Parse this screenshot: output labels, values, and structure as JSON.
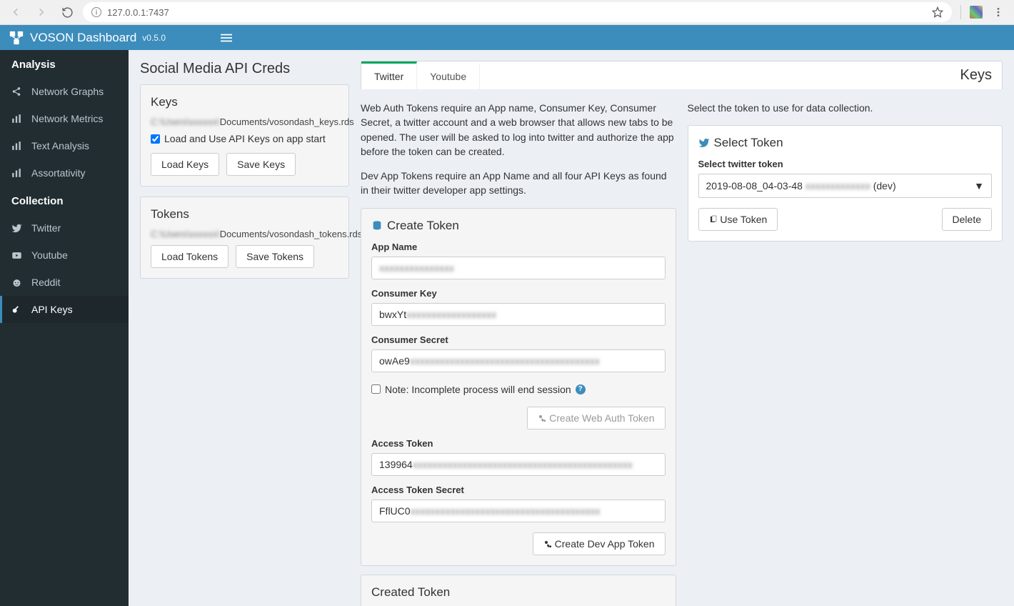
{
  "browser": {
    "url": "127.0.0.1:7437"
  },
  "header": {
    "title": "VOSON Dashboard",
    "version": "v0.5.0"
  },
  "sidebar": {
    "section1": "Analysis",
    "items1": [
      {
        "label": "Network Graphs"
      },
      {
        "label": "Network Metrics"
      },
      {
        "label": "Text Analysis"
      },
      {
        "label": "Assortativity"
      }
    ],
    "section2": "Collection",
    "items2": [
      {
        "label": "Twitter"
      },
      {
        "label": "Youtube"
      },
      {
        "label": "Reddit"
      },
      {
        "label": "API Keys"
      }
    ]
  },
  "creds": {
    "title": "Social Media API Creds",
    "keys_header": "Keys",
    "keys_path_suffix": "Documents/vosondash_keys.rds",
    "load_keys_chk": "Load and Use API Keys on app start",
    "load_keys_btn": "Load Keys",
    "save_keys_btn": "Save Keys",
    "tokens_header": "Tokens",
    "tokens_path_suffix": "Documents/vosondash_tokens.rds",
    "load_tokens_btn": "Load Tokens",
    "save_tokens_btn": "Save Tokens"
  },
  "tabs": {
    "twitter": "Twitter",
    "youtube": "Youtube",
    "keys": "Keys"
  },
  "twitter": {
    "desc1": "Web Auth Tokens require an App name, Consumer Key, Consumer Secret, a twitter account and a web browser that allows new tabs to be opened. The user will be asked to log into twitter and authorize the app before the token can be created.",
    "desc2": "Dev App Tokens require an App Name and all four API Keys as found in their twitter developer app settings.",
    "create_header": "Create Token",
    "app_name_label": "App Name",
    "app_name_value": "",
    "consumer_key_label": "Consumer Key",
    "consumer_key_value": "bwxYt",
    "consumer_secret_label": "Consumer Secret",
    "consumer_secret_value": "owAe9",
    "note": "Note: Incomplete process will end session",
    "create_web_btn": "Create Web Auth Token",
    "access_token_label": "Access Token",
    "access_token_value": "139964",
    "access_secret_label": "Access Token Secret",
    "access_secret_value": "FflUC0",
    "create_dev_btn": "Create Dev App Token",
    "created_header": "Created Token"
  },
  "select": {
    "hint": "Select the token to use for data collection.",
    "header": "Select Token",
    "label": "Select twitter token",
    "value_prefix": "2019-08-08_04-03-48",
    "value_suffix": " (dev)",
    "use_btn": "Use Token",
    "delete_btn": "Delete"
  }
}
